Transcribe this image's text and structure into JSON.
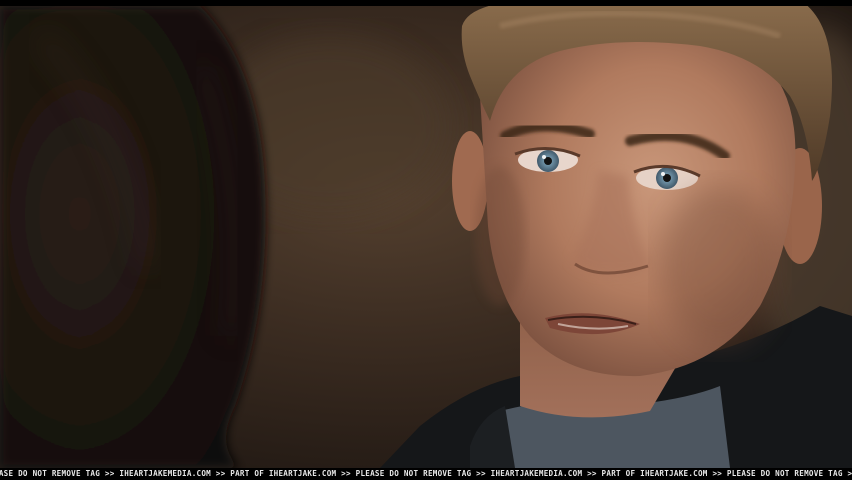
{
  "image": {
    "subject": "close-up film still of a man with blue eyes facing a blurred figure",
    "palette": {
      "background": "#2a1f18",
      "skin": "#b98569",
      "hair": "#6b5238",
      "eyes": "#6f93a8",
      "jacket": "#151719",
      "shirt": "#4d5660",
      "foreground_hair": "#1a1410"
    }
  },
  "watermark": {
    "text": "EASE DO NOT REMOVE TAG >> IHEARTJAKEMEDIA.COM >> PART OF IHEARTJAKE.COM >> PLEASE DO NOT REMOVE TAG >> IHEARTJAKEMEDIA.COM >> PART OF IHEARTJAKE.COM >> PLEASE DO NOT REMOVE TAG >> IHEARTJAKE"
  }
}
